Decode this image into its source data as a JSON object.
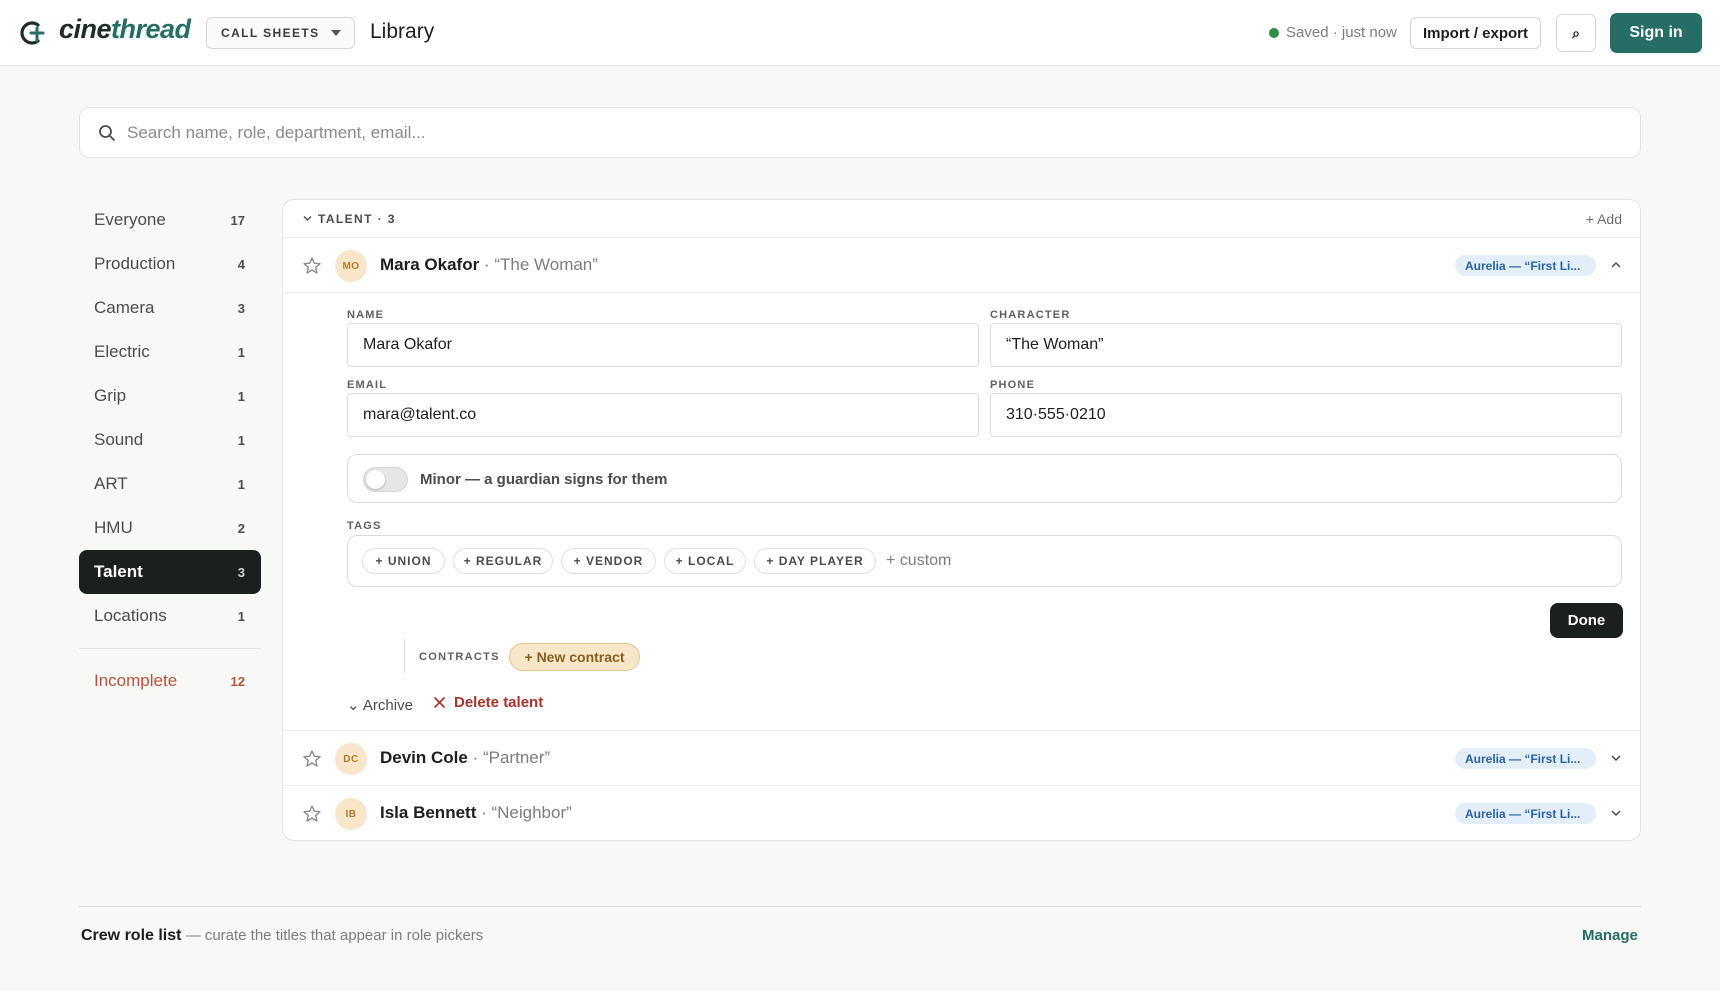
{
  "header": {
    "logo_prefix": "cine",
    "logo_accent": "thread",
    "mode_select": "CALL SHEETS",
    "title": "Library",
    "saved_status": "Saved · just now",
    "import_export": "Import / export",
    "search_glyph": "⌕",
    "sign_in": "Sign in"
  },
  "search": {
    "placeholder": "Search name, role, department, email..."
  },
  "sidebar": {
    "items": [
      {
        "label": "Everyone",
        "count": "17"
      },
      {
        "label": "Production",
        "count": "4"
      },
      {
        "label": "Camera",
        "count": "3"
      },
      {
        "label": "Electric",
        "count": "1"
      },
      {
        "label": "Grip",
        "count": "1"
      },
      {
        "label": "Sound",
        "count": "1"
      },
      {
        "label": "ART",
        "count": "1"
      },
      {
        "label": "HMU",
        "count": "2"
      },
      {
        "label": "Talent",
        "count": "3"
      },
      {
        "label": "Locations",
        "count": "1"
      }
    ],
    "active": "Talent",
    "incomplete": {
      "label": "Incomplete",
      "count": "12"
    }
  },
  "group": {
    "label": "TALENT · 3",
    "add": "+ Add"
  },
  "people": [
    {
      "initials": "MO",
      "name": "Mara Okafor",
      "character": "· “The Woman”",
      "badge": "Aurelia — “First Li...",
      "expanded": true
    },
    {
      "initials": "DC",
      "name": "Devin Cole",
      "character": "· “Partner”",
      "badge": "Aurelia — “First Li...",
      "expanded": false
    },
    {
      "initials": "IB",
      "name": "Isla Bennett",
      "character": "· “Neighbor”",
      "badge": "Aurelia — “First Li...",
      "expanded": false
    }
  ],
  "editor": {
    "name_label": "NAME",
    "name_value": "Mara Okafor",
    "character_label": "CHARACTER",
    "character_value": "“The Woman”",
    "email_label": "EMAIL",
    "email_value": "mara@talent.co",
    "phone_label": "PHONE",
    "phone_value": "310·555·0210",
    "minor_label": "Minor — a guardian signs for them",
    "minor_on": false,
    "tags_label": "TAGS",
    "tags": [
      "+ UNION",
      "+ REGULAR",
      "+ VENDOR",
      "+ LOCAL",
      "+ DAY PLAYER"
    ],
    "tag_custom": "+ custom",
    "done": "Done",
    "contracts_label": "CONTRACTS",
    "new_contract": "+ New contract",
    "archive": "⌄ Archive",
    "delete": "Delete talent"
  },
  "footer": {
    "title": "Crew role list",
    "subtitle": " — curate the titles that appear in role pickers",
    "manage": "Manage"
  },
  "colors": {
    "brand": "#256d65",
    "active_nav": "#1c1f20",
    "danger": "#a8322a",
    "warn": "#b4553a",
    "badge_text": "#2a63a5"
  }
}
